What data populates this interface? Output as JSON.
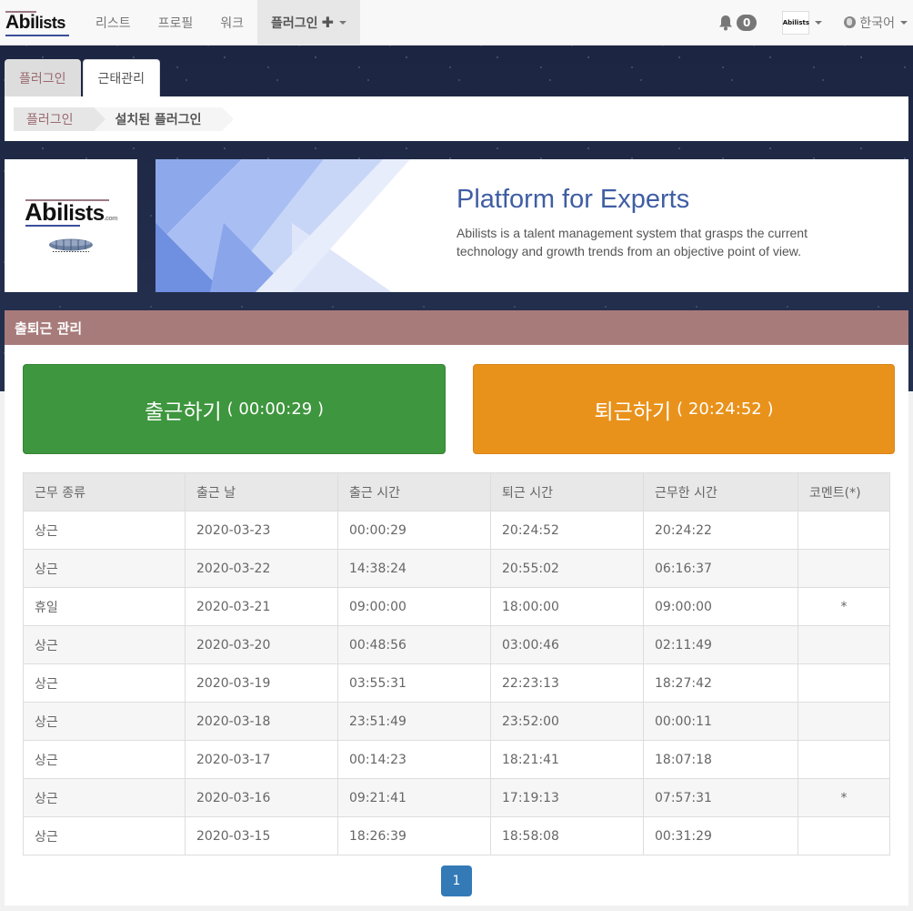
{
  "navbar": {
    "brand": {
      "abi": "Abi",
      "lists": "lists"
    },
    "items": [
      {
        "label": "리스트"
      },
      {
        "label": "프로필"
      },
      {
        "label": "워크"
      },
      {
        "label": "플러그인",
        "plus": "✚"
      }
    ],
    "notification_count": "0",
    "avatar_text": "Abilists",
    "language": "한국어"
  },
  "tabs": [
    {
      "label": "플러그인"
    },
    {
      "label": "근태관리"
    }
  ],
  "breadcrumb": [
    {
      "label": "플러그인"
    },
    {
      "label": "설치된 플러그인"
    }
  ],
  "logo_box": {
    "abi": "Abi",
    "lists": "lists",
    "com": ".com"
  },
  "banner": {
    "title": "Platform for Experts",
    "description": "Abilists is a talent management system that grasps the current technology and growth trends from an objective point of view."
  },
  "panel": {
    "heading": "출퇴근 관리",
    "check_in": {
      "label": "출근하기",
      "time": "( 00:00:29 )",
      "color": "#3e963e"
    },
    "check_out": {
      "label": "퇴근하기",
      "time": "( 20:24:52 )",
      "color": "#e9921b"
    }
  },
  "table": {
    "headers": [
      "근무 종류",
      "출근 날",
      "출근 시간",
      "퇴근 시간",
      "근무한 시간",
      "코멘트(*)"
    ],
    "rows": [
      [
        "상근",
        "2020-03-23",
        "00:00:29",
        "20:24:52",
        "20:24:22",
        ""
      ],
      [
        "상근",
        "2020-03-22",
        "14:38:24",
        "20:55:02",
        "06:16:37",
        ""
      ],
      [
        "휴일",
        "2020-03-21",
        "09:00:00",
        "18:00:00",
        "09:00:00",
        "*"
      ],
      [
        "상근",
        "2020-03-20",
        "00:48:56",
        "03:00:46",
        "02:11:49",
        ""
      ],
      [
        "상근",
        "2020-03-19",
        "03:55:31",
        "22:23:13",
        "18:27:42",
        ""
      ],
      [
        "상근",
        "2020-03-18",
        "23:51:49",
        "23:52:00",
        "00:00:11",
        ""
      ],
      [
        "상근",
        "2020-03-17",
        "00:14:23",
        "18:21:41",
        "18:07:18",
        ""
      ],
      [
        "상근",
        "2020-03-16",
        "09:21:41",
        "17:19:13",
        "07:57:31",
        "*"
      ],
      [
        "상근",
        "2020-03-15",
        "18:26:39",
        "18:58:08",
        "00:31:29",
        ""
      ]
    ]
  },
  "pagination": {
    "current_page": "1"
  }
}
